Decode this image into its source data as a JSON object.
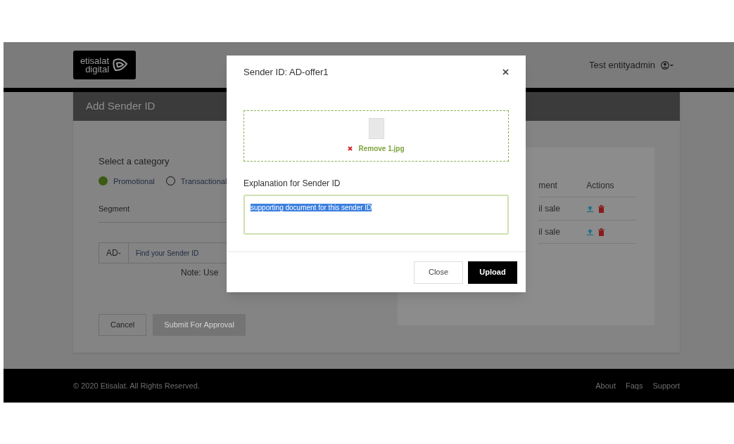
{
  "header": {
    "logo": [
      "etisalat",
      "digital"
    ],
    "user": "Test entityadmin"
  },
  "card": {
    "title": "Add Sender ID",
    "category_label": "Select a category",
    "categories": [
      {
        "label": "Promotional",
        "selected": true
      },
      {
        "label": "Transactional",
        "selected": false
      }
    ],
    "segment_label": "Segment",
    "prefix": "AD-",
    "search": {
      "placeholder": "Find your Sender ID"
    },
    "note": "Note: Use",
    "buttons": [
      {
        "label": "Cancel",
        "disabled": false
      },
      {
        "label": "Submit For Approval",
        "disabled": true
      }
    ]
  },
  "table": {
    "columns": [
      "ment",
      "Actions"
    ],
    "rows": [
      {
        "column_1": "il sale"
      },
      {
        "column_1": "il sale"
      }
    ]
  },
  "modal": {
    "title": "Sender ID: AD-offer1",
    "remove_label": "Remove 1.jpg",
    "explanation_label": "Explanation for Sender ID",
    "explanation": {
      "value": "supporting document for this sender ID",
      "selected": true
    },
    "buttons": [
      {
        "label": "Close",
        "kind": "secondary"
      },
      {
        "label": "Upload",
        "kind": "primary"
      }
    ]
  },
  "footer": {
    "copyright": "© 2020 Etisalat. All Rights Reserved.",
    "links": [
      "About",
      "Faqs",
      "Support"
    ]
  }
}
